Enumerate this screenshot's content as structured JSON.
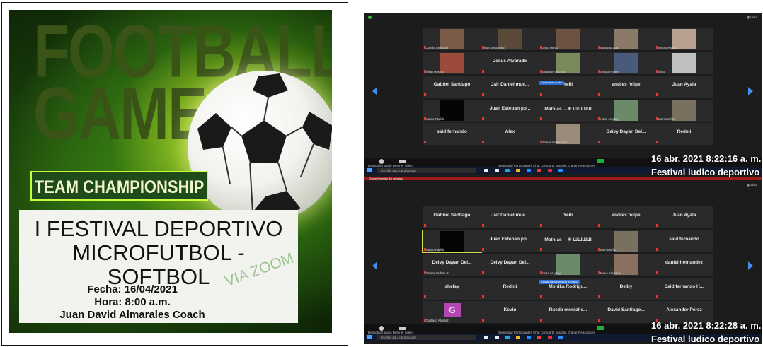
{
  "poster": {
    "headline_1": "FOOTBALL",
    "headline_2": "GAME",
    "banner": "TEAM CHAMPIONSHIP",
    "title": "I FESTIVAL DEPORTIVO MICROFUTBOL - SOFTBOL",
    "date_line": "Fecha: 16/04/2021",
    "time_line": "Hora: 8:00 a.m.",
    "coach_line": "Juan David Almarales Coach",
    "via_zoom": "VIA ZOOM"
  },
  "zoom_top": {
    "tiles": [
      {
        "name": "",
        "label": "Camila Delgado",
        "video": true,
        "color": "#7c5a48"
      },
      {
        "name": "",
        "label": "Juan Sebastian",
        "video": true,
        "color": "#5a4a3a"
      },
      {
        "name": "",
        "label": "Dana perez",
        "video": true,
        "color": "#6b5242"
      },
      {
        "name": "",
        "label": "Sara Estrada",
        "video": true,
        "color": "#8a7a6a"
      },
      {
        "name": "",
        "label": "Tomas Rojas",
        "video": true,
        "color": "#b8a090"
      },
      {
        "name": "",
        "label": "Milan Hostos",
        "video": true,
        "color": "#9c4a3a"
      },
      {
        "name": "Jesus Alvarado",
        "label": "",
        "video": false
      },
      {
        "name": "",
        "label": "Santiago Orozco",
        "video": true,
        "color": "#7a8a5a"
      },
      {
        "name": "",
        "label": "Sergio Andres",
        "video": true,
        "color": "#4a5a7a"
      },
      {
        "name": "",
        "label": "Silva",
        "video": true,
        "color": "#c0c0c0"
      },
      {
        "name": "Gabriel Santiago",
        "label": "",
        "video": false
      },
      {
        "name": "Jair Daniel mue...",
        "label": "",
        "video": false
      },
      {
        "name": "Yeili",
        "label": "",
        "video": false
      },
      {
        "name": "andres felipe",
        "label": "",
        "video": false
      },
      {
        "name": "Juan Ayala",
        "label": "",
        "video": false
      },
      {
        "name": "",
        "label": "Mateo Padilla",
        "video": true,
        "color": "#050505"
      },
      {
        "name": "Juan Esteban po...",
        "label": "",
        "video": false
      },
      {
        "name": "Mathias →☀ ШШШШ",
        "label": "",
        "video": false
      },
      {
        "name": "",
        "label": "mosa en play",
        "video": true,
        "color": "#6a8a6a"
      },
      {
        "name": "",
        "label": "Juan Muñoz",
        "video": true,
        "color": "#7a7060"
      },
      {
        "name": "said fernando",
        "label": "",
        "video": false
      },
      {
        "name": "Alex",
        "label": "",
        "video": false
      },
      {
        "name": "",
        "label": "Deiner andres Ruiz",
        "video": true,
        "color": "#9a8a7a"
      },
      {
        "name": "Deivy Dayan Del...",
        "label": "",
        "video": false
      },
      {
        "name": "Redmi",
        "label": "",
        "video": false
      }
    ],
    "tooltip": "Desactivar audio",
    "timestamp": "16 abr. 2021 8:22:16 a. m.",
    "festival": "Festival ludico deportivo",
    "toolbar_left": "Desactivar audio   Detener video",
    "toolbar_mid": "Seguridad   Participantes   Chat   Compartir pantalla   Grabar   Reacciones",
    "search": "Escribe aquí para buscar"
  },
  "zoom_bottom": {
    "redbar": "Zoom Reunión 40 minutos",
    "tiles": [
      {
        "name": "Gabriel Santiago",
        "label": "",
        "video": false
      },
      {
        "name": "Jair Daniel mue...",
        "label": "",
        "video": false
      },
      {
        "name": "Yeili",
        "label": "",
        "video": false
      },
      {
        "name": "andres felipe",
        "label": "",
        "video": false
      },
      {
        "name": "Juan Ayala",
        "label": "",
        "video": false
      },
      {
        "name": "",
        "label": "Mateo Padilla",
        "video": true,
        "color": "#050505",
        "active": true
      },
      {
        "name": "Juan Esteban po...",
        "label": "",
        "video": false
      },
      {
        "name": "Mathias →☀ ШШШШ",
        "label": "",
        "video": false
      },
      {
        "name": "",
        "label": "Juan Muñoz",
        "video": true,
        "color": "#7a7060"
      },
      {
        "name": "said fernando",
        "label": "",
        "video": false
      },
      {
        "name": "",
        "label": "Deiner andres R...",
        "video": false,
        "customname": "Deivy Dayan Del..."
      },
      {
        "name": "Deivy Dayan Del...",
        "label": "",
        "video": false
      },
      {
        "name": "",
        "label": "mosa en play",
        "video": true,
        "color": "#6a8a6a"
      },
      {
        "name": "",
        "label": "Jesus Alvarado",
        "video": true,
        "color": "#8a7060"
      },
      {
        "name": "daniel hernandez",
        "label": "",
        "video": false
      },
      {
        "name": "shelsy",
        "label": "",
        "video": false
      },
      {
        "name": "Redmi",
        "label": "",
        "video": false
      },
      {
        "name": "Monika Rodrigu...",
        "label": "",
        "video": false
      },
      {
        "name": "Deiby",
        "label": "",
        "video": false
      },
      {
        "name": "Said fernando H...",
        "label": "",
        "video": false
      },
      {
        "name": "",
        "label": "Gustavo Alvarez",
        "video": false,
        "avatar": "G"
      },
      {
        "name": "Kevin",
        "label": "",
        "video": false
      },
      {
        "name": "Rueda montalle...",
        "label": "",
        "video": false
      },
      {
        "name": "David Santiago...",
        "label": "",
        "video": false
      },
      {
        "name": "Alexander Pérez",
        "label": "",
        "video": false
      }
    ],
    "tooltip": "Anular para reactivar el audio",
    "timestamp": "16 abr. 2021 8:22:28 a. m.",
    "festival": "Festival ludico deportivo",
    "toolbar_left": "Desactivar audio   Detener video",
    "toolbar_mid": "Seguridad   Participantes   Chat   Compartir pantalla   Grabar   Reacciones",
    "search": "Escribe aquí para buscar"
  },
  "colors": {
    "zoom_blue": "#3d8ef0",
    "tile_bg": "#2a2a2a",
    "active_border": "#d3dd4a",
    "avatar": "#b447b4"
  }
}
